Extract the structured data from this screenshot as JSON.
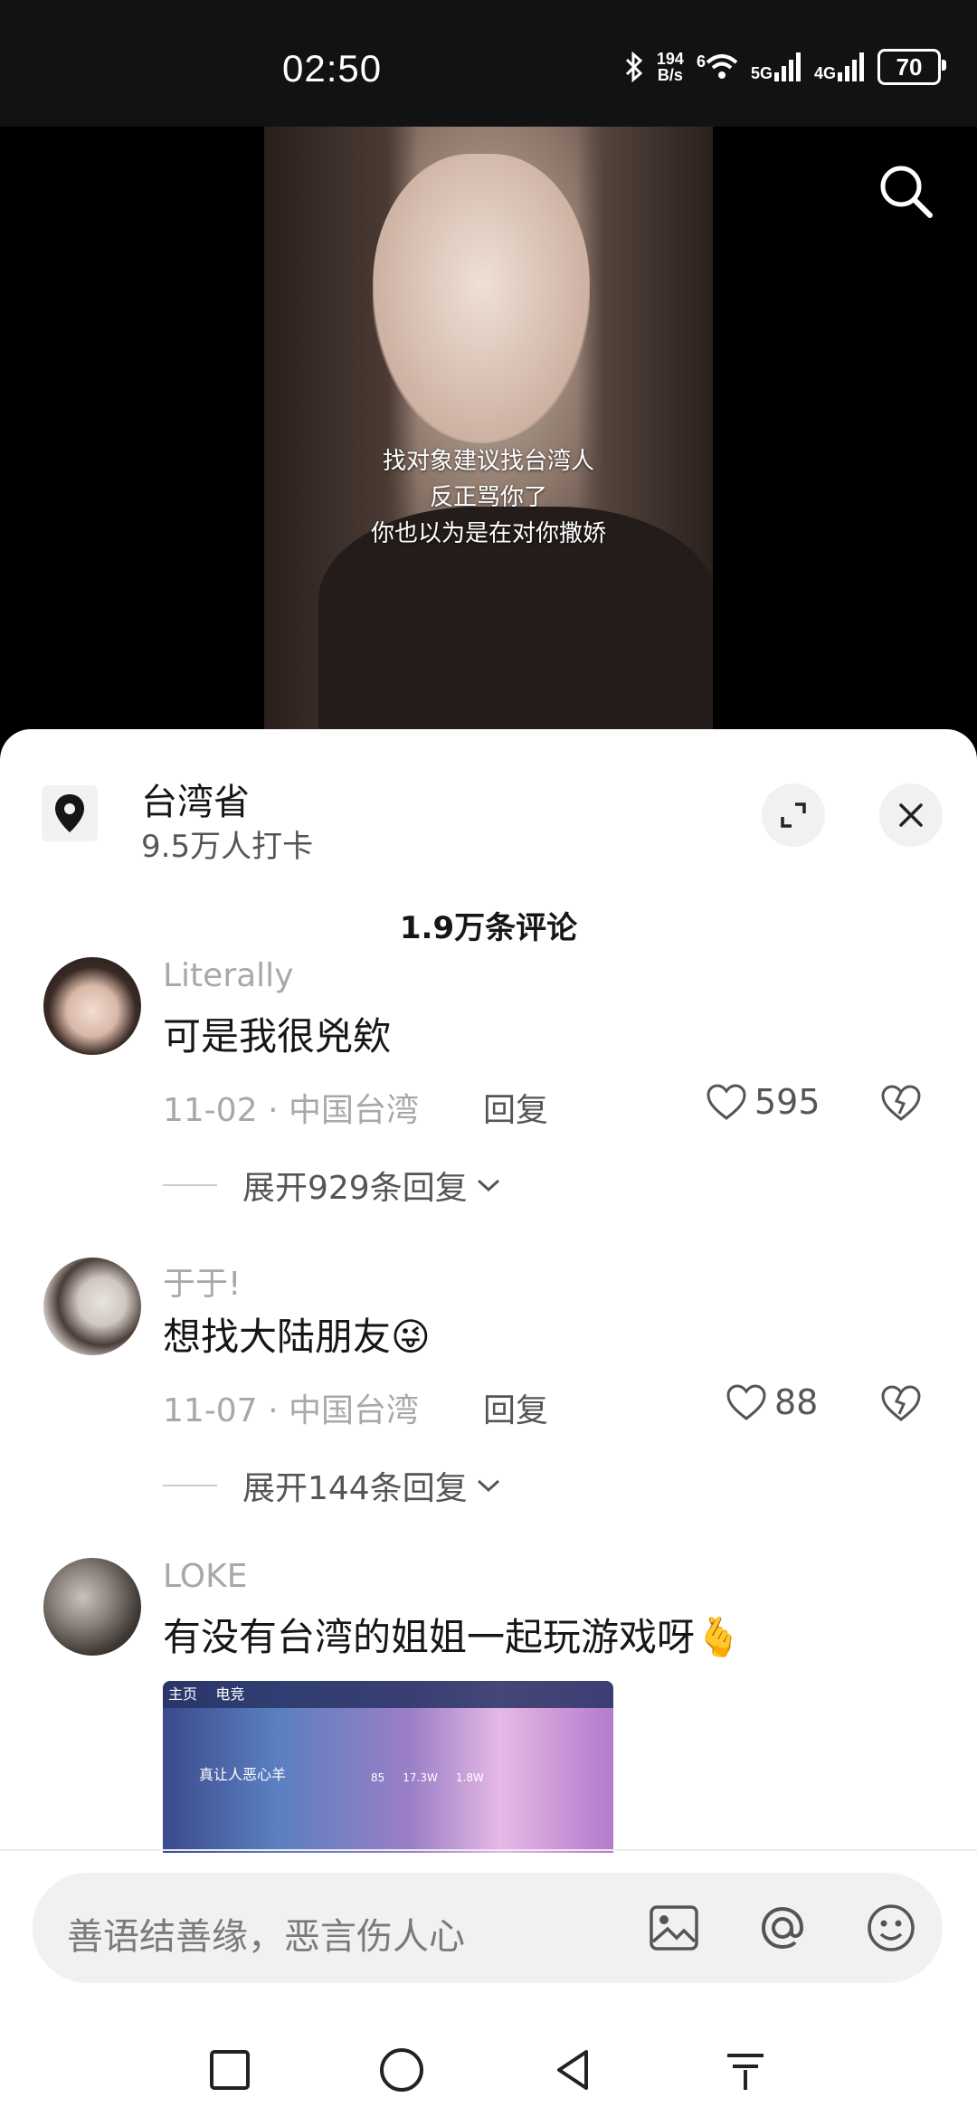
{
  "status_bar": {
    "time": "02:50",
    "net_speed_top": "194",
    "net_speed_bottom": "B/s",
    "wifi_label": "6",
    "signal_1": "5G",
    "signal_2": "4G",
    "battery": "70"
  },
  "video": {
    "subtitle_lines": [
      "找对象建议找台湾人",
      "反正骂你了",
      "你也以为是在对你撒娇"
    ]
  },
  "location": {
    "title": "台湾省",
    "subtitle": "9.5万人打卡"
  },
  "comments_header": "1.9万条评论",
  "comments": [
    {
      "user": "Literally",
      "text": "可是我很兇欸",
      "date": "11-02",
      "region": "中国台湾",
      "reply_label": "回复",
      "likes": "595",
      "expand_label": "展开929条回复"
    },
    {
      "user": "于于!",
      "text": "想找大陆朋友",
      "emoji": "😜",
      "date": "11-07",
      "region": "中国台湾",
      "reply_label": "回复",
      "likes": "88",
      "expand_label": "展开144条回复"
    },
    {
      "user": "LOKE",
      "text": "有没有台湾的姐姐一起玩游戏呀",
      "emoji": "🫰"
    }
  ],
  "game_image": {
    "tab_1": "主页",
    "tab_2": "电竞",
    "player": "真让人恶心羊",
    "stat_1": "85",
    "stat_2": "17.3W",
    "stat_3": "1.8W"
  },
  "meta_separator": "·",
  "input": {
    "placeholder": "善语结善缘，恶言伤人心"
  },
  "colors": {
    "sheet_bg": "#ffffff",
    "muted_text": "#a8a8a8",
    "primary_text": "#161616",
    "input_bg": "#f1f1f1"
  }
}
